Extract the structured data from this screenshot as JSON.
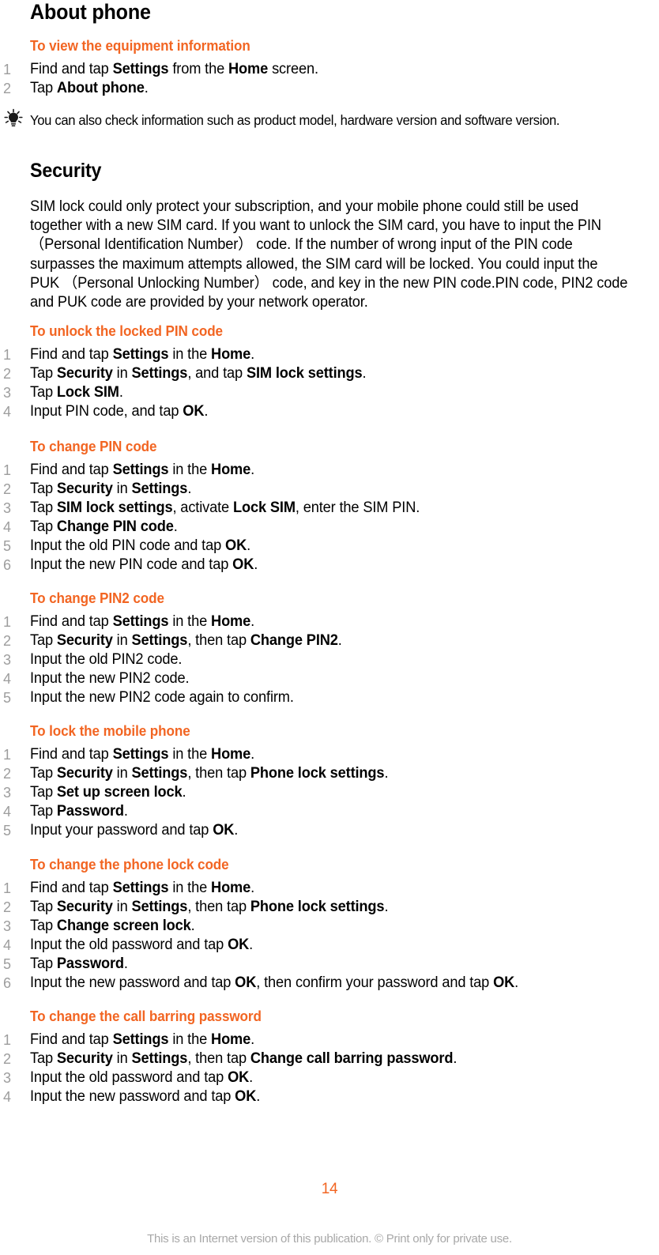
{
  "document": {
    "chapter_title": "About phone",
    "section_title": "Security",
    "security_paragraph": "SIM lock could only protect your subscription, and your mobile phone could still be used together with a new SIM card. If you want to unlock the SIM card, you have to input the PIN （Personal Identification Number） code. If the number of wrong input of the PIN code surpasses the maximum attempts allowed, the SIM card will be locked. You could input the PUK （Personal Unlocking Number） code, and key in the new PIN code.PIN code, PIN2 code and PUK code are provided by your network operator.",
    "tip": {
      "icon": "lightbulb-icon",
      "text": "You can also check information such as product model, hardware version and software version."
    },
    "page_number": "14",
    "footer_note": "This is an Internet version of this publication. © Print only for private use.",
    "accent_color": "#F26522",
    "list_number_color": "#9D9D9D",
    "footer_color": "#A8A8A8"
  },
  "procedures": [
    {
      "title": "To view the equipment information",
      "steps": [
        {
          "n": "1",
          "parts": [
            {
              "t": "Find and tap ",
              "b": false
            },
            {
              "t": "Settings",
              "b": true
            },
            {
              "t": " from the ",
              "b": false
            },
            {
              "t": "Home",
              "b": true
            },
            {
              "t": " screen.",
              "b": false
            }
          ]
        },
        {
          "n": "2",
          "parts": [
            {
              "t": "Tap ",
              "b": false
            },
            {
              "t": "About phone",
              "b": true
            },
            {
              "t": ".",
              "b": false
            }
          ]
        }
      ]
    },
    {
      "title": "To unlock the locked PIN code",
      "steps": [
        {
          "n": "1",
          "parts": [
            {
              "t": "Find and tap ",
              "b": false
            },
            {
              "t": "Settings",
              "b": true
            },
            {
              "t": " in the ",
              "b": false
            },
            {
              "t": "Home",
              "b": true
            },
            {
              "t": ".",
              "b": false
            }
          ]
        },
        {
          "n": "2",
          "parts": [
            {
              "t": "Tap ",
              "b": false
            },
            {
              "t": "Security",
              "b": true
            },
            {
              "t": " in ",
              "b": false
            },
            {
              "t": "Settings",
              "b": true
            },
            {
              "t": ", and tap ",
              "b": false
            },
            {
              "t": "SIM lock settings",
              "b": true
            },
            {
              "t": ".",
              "b": false
            }
          ]
        },
        {
          "n": "3",
          "parts": [
            {
              "t": "Tap ",
              "b": false
            },
            {
              "t": "Lock SIM",
              "b": true
            },
            {
              "t": ".",
              "b": false
            }
          ]
        },
        {
          "n": "4",
          "parts": [
            {
              "t": "Input PIN code, and tap ",
              "b": false
            },
            {
              "t": "OK",
              "b": true
            },
            {
              "t": ".",
              "b": false
            }
          ]
        }
      ]
    },
    {
      "title": "To change PIN code",
      "steps": [
        {
          "n": "1",
          "parts": [
            {
              "t": "Find and tap ",
              "b": false
            },
            {
              "t": "Settings",
              "b": true
            },
            {
              "t": " in the ",
              "b": false
            },
            {
              "t": "Home",
              "b": true
            },
            {
              "t": ".",
              "b": false
            }
          ]
        },
        {
          "n": "2",
          "parts": [
            {
              "t": "Tap ",
              "b": false
            },
            {
              "t": "Security",
              "b": true
            },
            {
              "t": " in ",
              "b": false
            },
            {
              "t": "Settings",
              "b": true
            },
            {
              "t": ".",
              "b": false
            }
          ]
        },
        {
          "n": "3",
          "parts": [
            {
              "t": "Tap ",
              "b": false
            },
            {
              "t": "SIM lock settings",
              "b": true
            },
            {
              "t": ", activate ",
              "b": false
            },
            {
              "t": "Lock SIM",
              "b": true
            },
            {
              "t": ", enter the SIM PIN.",
              "b": false
            }
          ]
        },
        {
          "n": "4",
          "parts": [
            {
              "t": "Tap ",
              "b": false
            },
            {
              "t": "Change PIN code",
              "b": true
            },
            {
              "t": ".",
              "b": false
            }
          ]
        },
        {
          "n": "5",
          "parts": [
            {
              "t": "Input the old PIN code and tap ",
              "b": false
            },
            {
              "t": "OK",
              "b": true
            },
            {
              "t": ".",
              "b": false
            }
          ]
        },
        {
          "n": "6",
          "parts": [
            {
              "t": "Input the new PIN code and tap ",
              "b": false
            },
            {
              "t": "OK",
              "b": true
            },
            {
              "t": ".",
              "b": false
            }
          ]
        }
      ]
    },
    {
      "title": "To change PIN2 code",
      "steps": [
        {
          "n": "1",
          "parts": [
            {
              "t": "Find and tap ",
              "b": false
            },
            {
              "t": "Settings",
              "b": true
            },
            {
              "t": " in the ",
              "b": false
            },
            {
              "t": "Home",
              "b": true
            },
            {
              "t": ".",
              "b": false
            }
          ]
        },
        {
          "n": "2",
          "parts": [
            {
              "t": "Tap ",
              "b": false
            },
            {
              "t": "Security",
              "b": true
            },
            {
              "t": " in ",
              "b": false
            },
            {
              "t": "Settings",
              "b": true
            },
            {
              "t": ", then tap ",
              "b": false
            },
            {
              "t": "Change PIN2",
              "b": true
            },
            {
              "t": ".",
              "b": false
            }
          ]
        },
        {
          "n": "3",
          "parts": [
            {
              "t": "Input the old PIN2 code.",
              "b": false
            }
          ]
        },
        {
          "n": "4",
          "parts": [
            {
              "t": "Input the new PIN2 code.",
              "b": false
            }
          ]
        },
        {
          "n": "5",
          "parts": [
            {
              "t": "Input the new PIN2 code again to confirm.",
              "b": false
            }
          ]
        }
      ]
    },
    {
      "title": "To lock the mobile phone",
      "steps": [
        {
          "n": "1",
          "parts": [
            {
              "t": "Find and tap ",
              "b": false
            },
            {
              "t": "Settings",
              "b": true
            },
            {
              "t": " in the ",
              "b": false
            },
            {
              "t": "Home",
              "b": true
            },
            {
              "t": ".",
              "b": false
            }
          ]
        },
        {
          "n": "2",
          "parts": [
            {
              "t": "Tap ",
              "b": false
            },
            {
              "t": "Security",
              "b": true
            },
            {
              "t": " in ",
              "b": false
            },
            {
              "t": "Settings",
              "b": true
            },
            {
              "t": ", then tap ",
              "b": false
            },
            {
              "t": "Phone lock settings",
              "b": true
            },
            {
              "t": ".",
              "b": false
            }
          ]
        },
        {
          "n": "3",
          "parts": [
            {
              "t": "Tap ",
              "b": false
            },
            {
              "t": "Set up screen lock",
              "b": true
            },
            {
              "t": ".",
              "b": false
            }
          ]
        },
        {
          "n": "4",
          "parts": [
            {
              "t": "Tap ",
              "b": false
            },
            {
              "t": "Password",
              "b": true
            },
            {
              "t": ".",
              "b": false
            }
          ]
        },
        {
          "n": "5",
          "parts": [
            {
              "t": "Input your password and tap ",
              "b": false
            },
            {
              "t": "OK",
              "b": true
            },
            {
              "t": ".",
              "b": false
            }
          ]
        }
      ]
    },
    {
      "title": "To change the phone lock code",
      "steps": [
        {
          "n": "1",
          "parts": [
            {
              "t": "Find and tap ",
              "b": false
            },
            {
              "t": "Settings",
              "b": true
            },
            {
              "t": " in the ",
              "b": false
            },
            {
              "t": "Home",
              "b": true
            },
            {
              "t": ".",
              "b": false
            }
          ]
        },
        {
          "n": "2",
          "parts": [
            {
              "t": "Tap ",
              "b": false
            },
            {
              "t": "Security",
              "b": true
            },
            {
              "t": " in ",
              "b": false
            },
            {
              "t": "Settings",
              "b": true
            },
            {
              "t": ", then tap ",
              "b": false
            },
            {
              "t": "Phone lock settings",
              "b": true
            },
            {
              "t": ".",
              "b": false
            }
          ]
        },
        {
          "n": "3",
          "parts": [
            {
              "t": "Tap ",
              "b": false
            },
            {
              "t": "Change screen lock",
              "b": true
            },
            {
              "t": ".",
              "b": false
            }
          ]
        },
        {
          "n": "4",
          "parts": [
            {
              "t": "Input the old password and tap ",
              "b": false
            },
            {
              "t": "OK",
              "b": true
            },
            {
              "t": ".",
              "b": false
            }
          ]
        },
        {
          "n": "5",
          "parts": [
            {
              "t": "Tap ",
              "b": false
            },
            {
              "t": "Password",
              "b": true
            },
            {
              "t": ".",
              "b": false
            }
          ]
        },
        {
          "n": "6",
          "parts": [
            {
              "t": "Input the new password and tap ",
              "b": false
            },
            {
              "t": "OK",
              "b": true
            },
            {
              "t": ", then confirm your password and tap ",
              "b": false
            },
            {
              "t": "OK",
              "b": true
            },
            {
              "t": ".",
              "b": false
            }
          ]
        }
      ]
    },
    {
      "title": "To change the call barring password",
      "steps": [
        {
          "n": "1",
          "parts": [
            {
              "t": "Find and tap ",
              "b": false
            },
            {
              "t": "Settings",
              "b": true
            },
            {
              "t": " in the ",
              "b": false
            },
            {
              "t": "Home",
              "b": true
            },
            {
              "t": ".",
              "b": false
            }
          ]
        },
        {
          "n": "2",
          "parts": [
            {
              "t": "Tap ",
              "b": false
            },
            {
              "t": "Security",
              "b": true
            },
            {
              "t": " in ",
              "b": false
            },
            {
              "t": "Settings",
              "b": true
            },
            {
              "t": ", then tap ",
              "b": false
            },
            {
              "t": "Change call barring password",
              "b": true
            },
            {
              "t": ".",
              "b": false
            }
          ]
        },
        {
          "n": "3",
          "parts": [
            {
              "t": "Input the old password and tap ",
              "b": false
            },
            {
              "t": "OK",
              "b": true
            },
            {
              "t": ".",
              "b": false
            }
          ]
        },
        {
          "n": "4",
          "parts": [
            {
              "t": "Input the new password and tap ",
              "b": false
            },
            {
              "t": "OK",
              "b": true
            },
            {
              "t": ".",
              "b": false
            }
          ]
        }
      ]
    }
  ]
}
